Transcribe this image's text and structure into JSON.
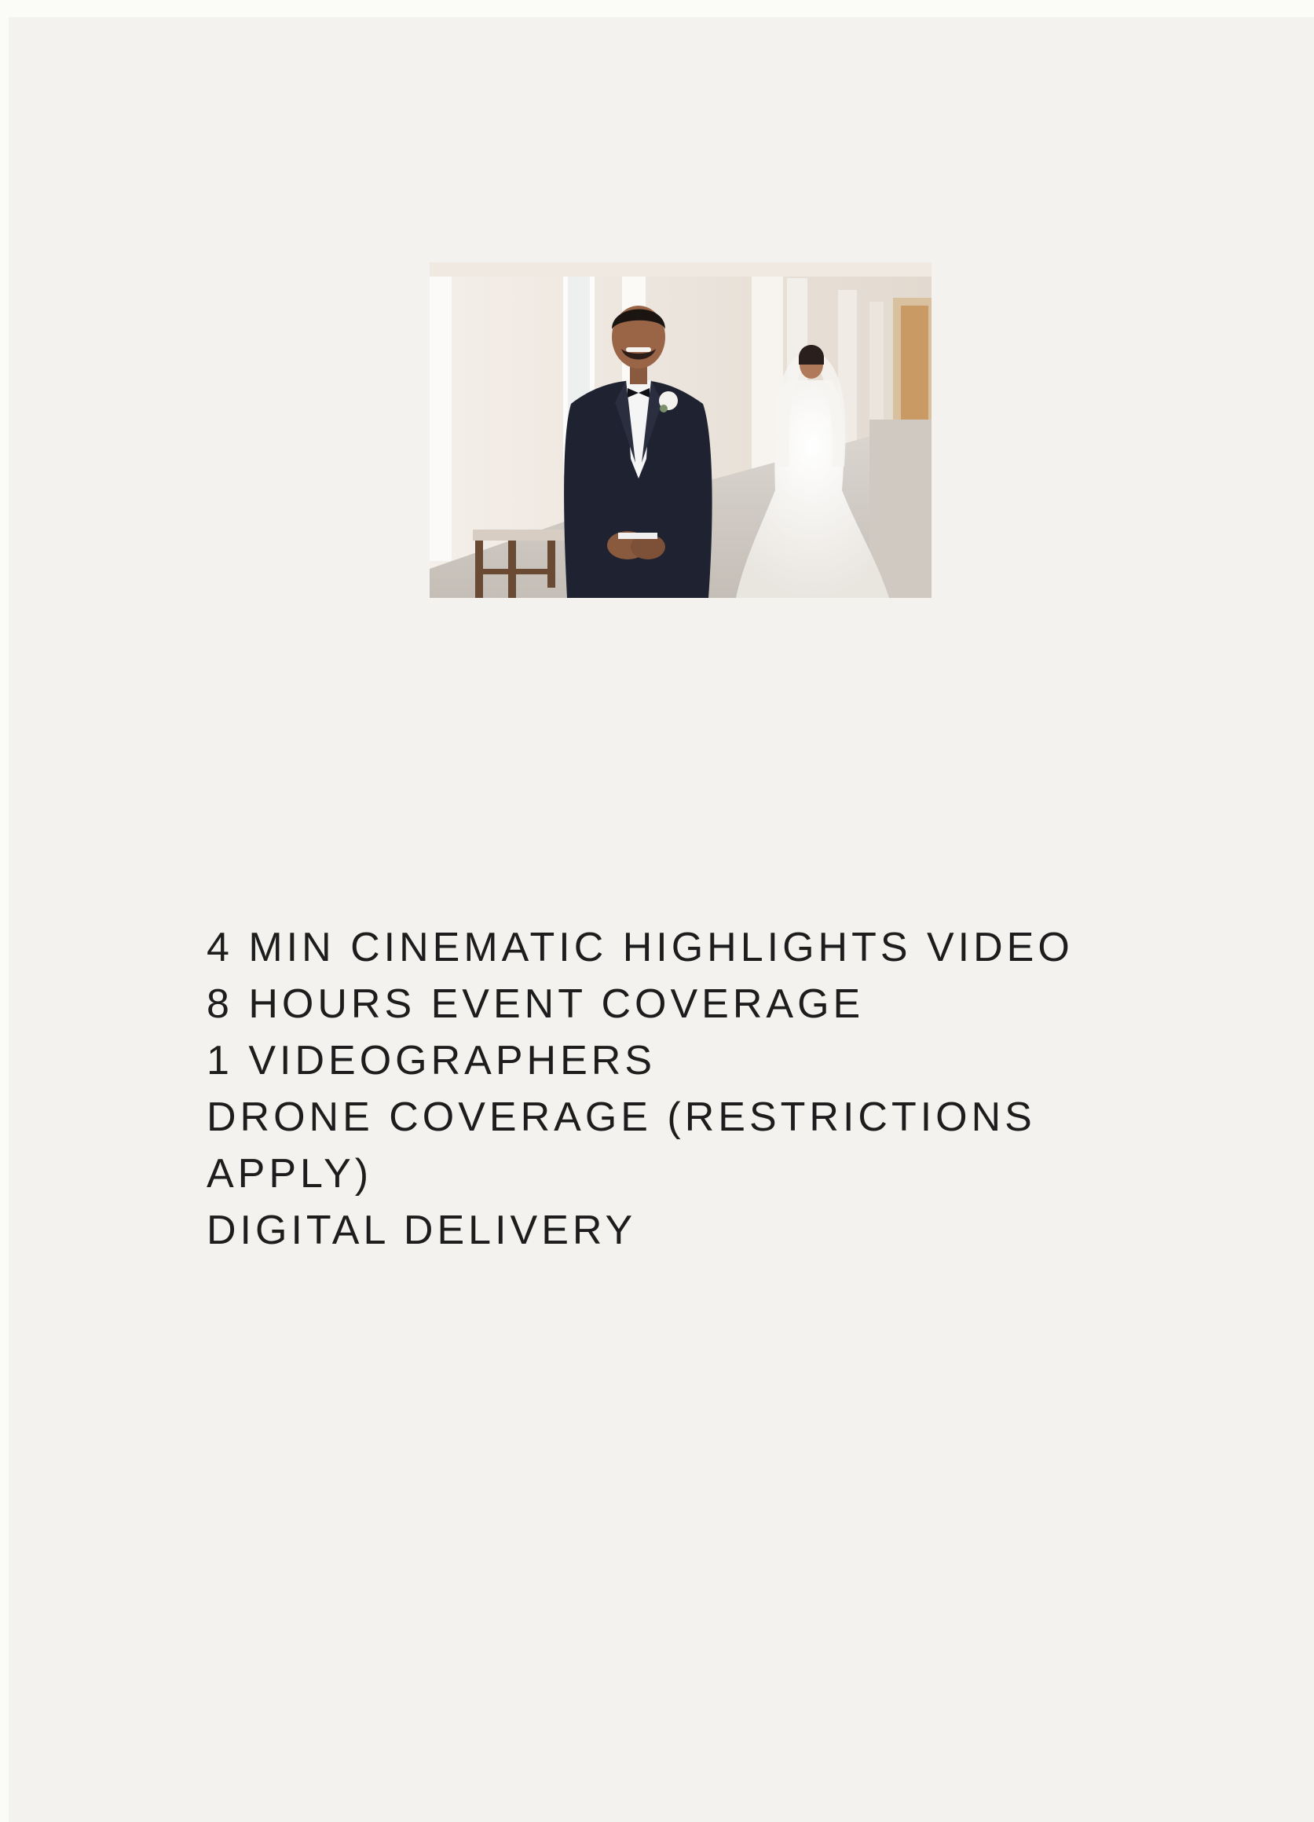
{
  "photo": {
    "alt": "Groom in black tuxedo smiling with bride in white lace gown standing behind him in a bright hallway",
    "colors": {
      "wall": "#ece6df",
      "floor": "#cfcac4",
      "suit": "#1f2230",
      "dress": "#f7f5f2",
      "door": "#c99a63"
    }
  },
  "features": [
    "4 MIN CINEMATIC HIGHLIGHTS VIDEO",
    "8 HOURS EVENT COVERAGE",
    "1 VIDEOGRAPHERS",
    "DRONE COVERAGE (RESTRICTIONS APPLY)",
    "DIGITAL DELIVERY"
  ]
}
